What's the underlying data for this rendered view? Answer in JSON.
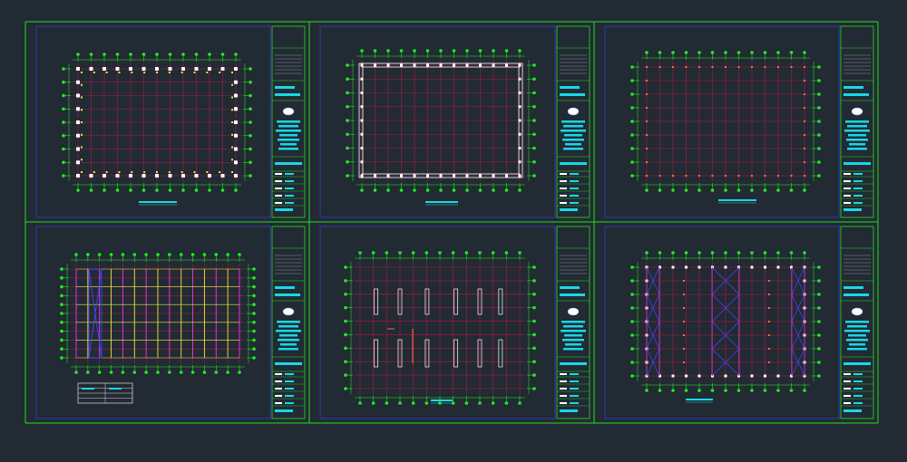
{
  "app": {
    "view": "model-space",
    "background": "#222a33"
  },
  "colors": {
    "border": "#22dd22",
    "grid_red": "#b01845",
    "axis_green": "#22ee22",
    "column_white": "#ffffff",
    "title_cyan": "#18d8e8",
    "brace_blue": "#3848ff",
    "beam_yellow": "#e8e840",
    "beam_magenta": "#e838e8",
    "accent_orange": "#ff7040"
  },
  "sheets": [
    {
      "name": "column-layout-plan",
      "icon": "company-logo-icon"
    },
    {
      "name": "anchor-bolt-plan",
      "icon": "company-logo-icon"
    },
    {
      "name": "foundation-plan",
      "icon": "company-logo-icon"
    },
    {
      "name": "roof-purlin-plan",
      "icon": "company-logo-icon"
    },
    {
      "name": "wall-elevation-plan",
      "icon": "company-logo-icon"
    },
    {
      "name": "bracing-layout-plan",
      "icon": "company-logo-icon"
    }
  ]
}
